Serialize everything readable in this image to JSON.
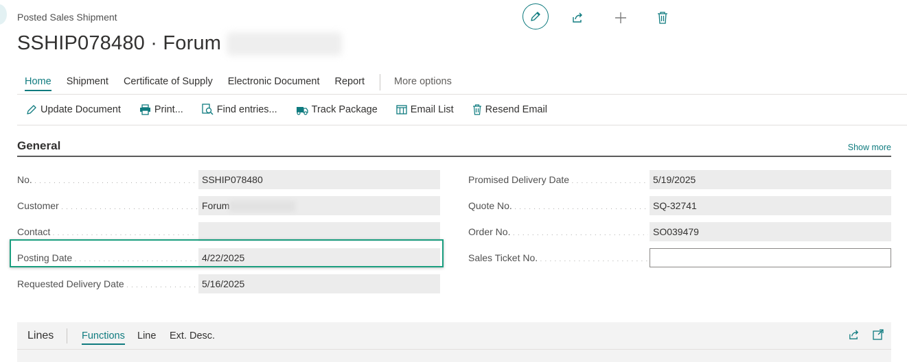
{
  "header": {
    "caption": "Posted Sales Shipment",
    "title_prefix": "SSHIP078480 · Forum"
  },
  "top_icons": [
    "edit-icon",
    "share-icon",
    "add-icon",
    "delete-icon"
  ],
  "tabs": [
    {
      "label": "Home",
      "active": true
    },
    {
      "label": "Shipment"
    },
    {
      "label": "Certificate of Supply"
    },
    {
      "label": "Electronic Document"
    },
    {
      "label": "Report"
    },
    {
      "label": "More options"
    }
  ],
  "actions": [
    {
      "label": "Update Document",
      "icon": "pencil-icon"
    },
    {
      "label": "Print...",
      "icon": "printer-icon"
    },
    {
      "label": "Find entries...",
      "icon": "find-entries-icon"
    },
    {
      "label": "Track Package",
      "icon": "truck-icon"
    },
    {
      "label": "Email List",
      "icon": "list-icon"
    },
    {
      "label": "Resend Email",
      "icon": "trash-icon"
    }
  ],
  "general": {
    "title": "General",
    "show_more": "Show more",
    "left_fields": [
      {
        "label": "No.",
        "value": "SSHIP078480"
      },
      {
        "label": "Customer",
        "value": "Forum"
      },
      {
        "label": "Contact",
        "value": ""
      },
      {
        "label": "Posting Date",
        "value": "4/22/2025"
      },
      {
        "label": "Requested Delivery Date",
        "value": "5/16/2025"
      }
    ],
    "right_fields": [
      {
        "label": "Promised Delivery Date",
        "value": "5/19/2025"
      },
      {
        "label": "Quote No.",
        "value": "SQ-32741"
      },
      {
        "label": "Order No.",
        "value": "SO039479"
      },
      {
        "label": "Sales Ticket No.",
        "value": ""
      }
    ]
  },
  "lines": {
    "title": "Lines",
    "tabs": [
      "Functions",
      "Line",
      "Ext. Desc."
    ]
  },
  "colors": {
    "accent": "#0f7b7f",
    "highlight": "#1a9e7f",
    "field_bg": "#ececec"
  }
}
